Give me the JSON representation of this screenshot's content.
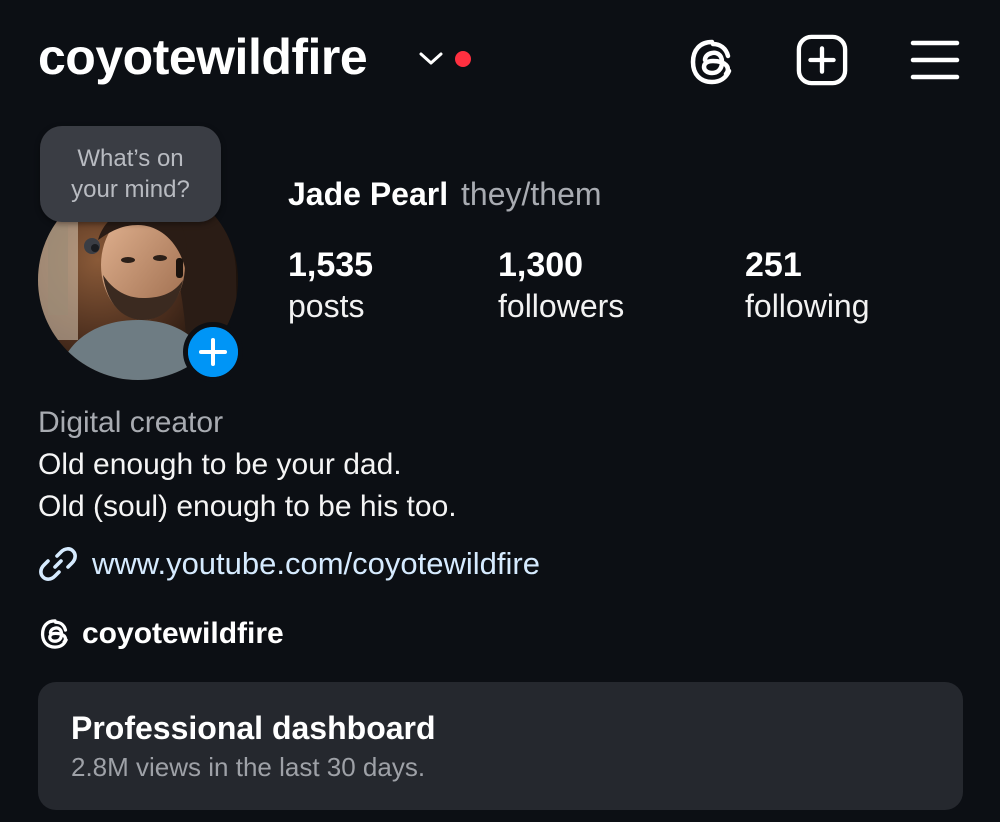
{
  "header": {
    "username": "coyotewildfire",
    "icons": [
      "chevron-down-icon",
      "threads-icon",
      "create-icon",
      "menu-icon"
    ],
    "notification_color": "#ff3040"
  },
  "note": {
    "text": "What’s on your mind?"
  },
  "profile": {
    "display_name": "Jade Pearl",
    "pronouns": "they/them",
    "add_story_icon": "plus-icon",
    "add_story_color": "#0095f6"
  },
  "stats": {
    "posts": {
      "value": "1,535",
      "label": "posts"
    },
    "followers": {
      "value": "1,300",
      "label": "followers"
    },
    "following": {
      "value": "251",
      "label": "following"
    }
  },
  "bio": {
    "category": "Digital creator",
    "lines": [
      "Old enough to be your dad.",
      "Old (soul) enough to be his too."
    ],
    "link": "www.youtube.com/coyotewildfire",
    "threads_handle": "coyotewildfire"
  },
  "dashboard": {
    "title": "Professional dashboard",
    "subtitle": "2.8M views in the last 30 days."
  },
  "colors": {
    "background": "#0c0f14",
    "card": "#25282e",
    "accent": "#0095f6",
    "link": "#d6ebff"
  }
}
